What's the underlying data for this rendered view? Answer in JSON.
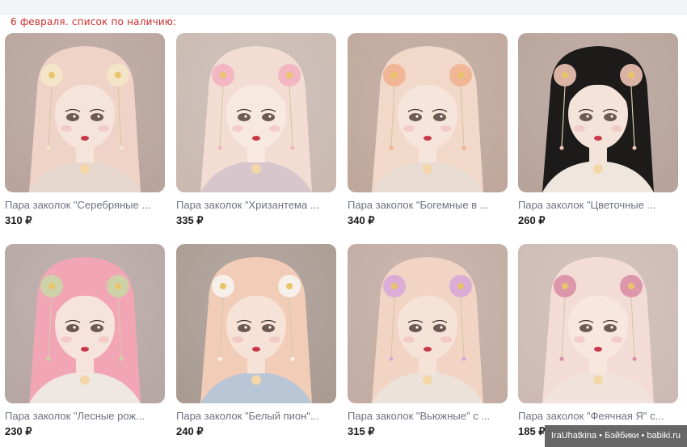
{
  "header": {
    "note": "6 февраля. список по наличию:"
  },
  "products": [
    {
      "title": "Пара заколок \"Серебряные ...",
      "price": "310 ₽",
      "palette": {
        "bg": "#b8a49c",
        "hair": "#efd3c6",
        "skin": "#f5e4da",
        "accent": "#f4e6c8",
        "dress": "#e7d8cf"
      }
    },
    {
      "title": "Пара заколок \"Хризантема ...",
      "price": "335 ₽",
      "palette": {
        "bg": "#c9b9b1",
        "hair": "#f3ddd2",
        "skin": "#f7e9e0",
        "accent": "#f2b3c0",
        "dress": "#d7c6cc"
      }
    },
    {
      "title": "Пара заколок \"Богемные в ...",
      "price": "340 ₽",
      "palette": {
        "bg": "#bfa79b",
        "hair": "#f1d8c9",
        "skin": "#f6e5da",
        "accent": "#f0b38f",
        "dress": "#e9dcd2"
      }
    },
    {
      "title": "Пара заколок \"Цветочные ...",
      "price": "260 ₽",
      "palette": {
        "bg": "#b7a39a",
        "hair": "#1d1a1a",
        "skin": "#f3e3d9",
        "accent": "#f1c4b4",
        "dress": "#efe6dd"
      }
    },
    {
      "title": "Пара заколок \"Лесные рож...",
      "price": "230 ₽",
      "palette": {
        "bg": "#b7a7a4",
        "hair": "#f2a6b5",
        "skin": "#f6e4dc",
        "accent": "#c9d7a6",
        "dress": "#efe7e2"
      }
    },
    {
      "title": "Пара заколок \"Белый пион\"...",
      "price": "240 ₽",
      "palette": {
        "bg": "#a99b92",
        "hair": "#f1cdb8",
        "skin": "#f6e2d6",
        "accent": "#f7f3ee",
        "dress": "#b9c6d6"
      }
    },
    {
      "title": "Пара заколок \"Вьюжные\" с ...",
      "price": "315 ₽",
      "palette": {
        "bg": "#c2aca3",
        "hair": "#f1d4c4",
        "skin": "#f6e3d8",
        "accent": "#d8a8d8",
        "dress": "#ede2da"
      }
    },
    {
      "title": "Пара заколок \"Феячная Я\" с...",
      "price": "185 ₽",
      "palette": {
        "bg": "#cdbab4",
        "hair": "#f4dcd6",
        "skin": "#f7e7df",
        "accent": "#d98fa6",
        "dress": "#efe3dc"
      }
    }
  ],
  "watermark": "IraUhatkina • Бэйбики • babiki.ru"
}
